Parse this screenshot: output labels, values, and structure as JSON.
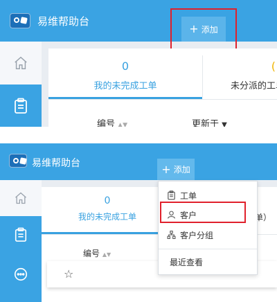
{
  "app": {
    "title": "易维帮助台"
  },
  "header": {
    "add_label": "添加",
    "add_icon": "plus-icon"
  },
  "tabs": [
    {
      "count": "0",
      "label": "我的未完成工单"
    },
    {
      "count": "",
      "label": "未分派的工单"
    }
  ],
  "tab2_partial_label": "抢单）",
  "columns": {
    "number": "编号",
    "updated": "更新于"
  },
  "dropdown": {
    "items": [
      {
        "label": "工单",
        "icon": "clipboard-icon"
      },
      {
        "label": "客户",
        "icon": "user-icon"
      },
      {
        "label": "客户分组",
        "icon": "org-tree-icon"
      },
      {
        "label": "最近查看",
        "icon": ""
      }
    ]
  },
  "colors": {
    "header": "#3aa3e3",
    "accent": "#38a1e0",
    "highlight_box": "#e0202b"
  }
}
